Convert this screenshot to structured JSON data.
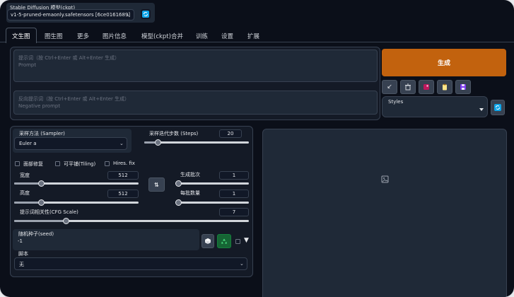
{
  "colors": {
    "primary": "#c2620e",
    "background": "#0b0f19",
    "panel": "#1f2937",
    "accent_green": "#166534",
    "accent_blue": "#0ea5e9"
  },
  "checkpoint": {
    "label": "Stable Diffusion 模型(ckpt)",
    "value": "v1-5-pruned-emaonly.safetensors [6ce0161689]",
    "refresh_icon": "refresh-icon"
  },
  "tabs": [
    {
      "label": "文生图",
      "active": true
    },
    {
      "label": "图生图"
    },
    {
      "label": "更多"
    },
    {
      "label": "图片信息"
    },
    {
      "label": "模型(ckpt)合并"
    },
    {
      "label": "训练"
    },
    {
      "label": "设置"
    },
    {
      "label": "扩展"
    }
  ],
  "prompt": {
    "label": "提示词（按 Ctrl+Enter 或 Alt+Enter 生成）",
    "placeholder": "Prompt"
  },
  "negative_prompt": {
    "label": "反向提示词（按 Ctrl+Enter 或 Alt+Enter 生成）",
    "placeholder": "Negative prompt"
  },
  "generate": {
    "label": "生成"
  },
  "tool_buttons": [
    {
      "icon": "arrow-down-left-icon",
      "glyph": "↙"
    },
    {
      "icon": "trash-icon",
      "glyph": "🗑"
    },
    {
      "icon": "image-pink-icon",
      "glyph": ""
    },
    {
      "icon": "clipboard-icon",
      "glyph": ""
    },
    {
      "icon": "save-icon",
      "glyph": ""
    }
  ],
  "styles": {
    "label": "Styles",
    "value": ""
  },
  "sampler": {
    "label": "采样方法 (Sampler)",
    "value": "Euler a"
  },
  "steps": {
    "label": "采样迭代步数 (Steps)",
    "value": "20",
    "fraction": 0.13
  },
  "options": {
    "restore_faces": "面部修复",
    "tiling": "可平铺(Tiling)",
    "hires_fix": "Hires. fix"
  },
  "width": {
    "label": "宽度",
    "value": "512",
    "fraction": 0.22
  },
  "height": {
    "label": "高度",
    "value": "512",
    "fraction": 0.22
  },
  "swap_icon": "swap-icon",
  "batch_count": {
    "label": "生成批次",
    "value": "1",
    "fraction": 0.0
  },
  "batch_size": {
    "label": "每批数量",
    "value": "1",
    "fraction": 0.0
  },
  "cfg": {
    "label": "提示词相关性(CFG Scale)",
    "value": "7",
    "fraction": 0.22
  },
  "seed": {
    "label": "随机种子(seed)",
    "value": "-1",
    "dice_icon": "dice-icon",
    "recycle_icon": "recycle-icon",
    "extra": "▼"
  },
  "script": {
    "label": "脚本",
    "value": "无"
  },
  "output": {
    "placeholder_icon": "image-placeholder-icon"
  }
}
